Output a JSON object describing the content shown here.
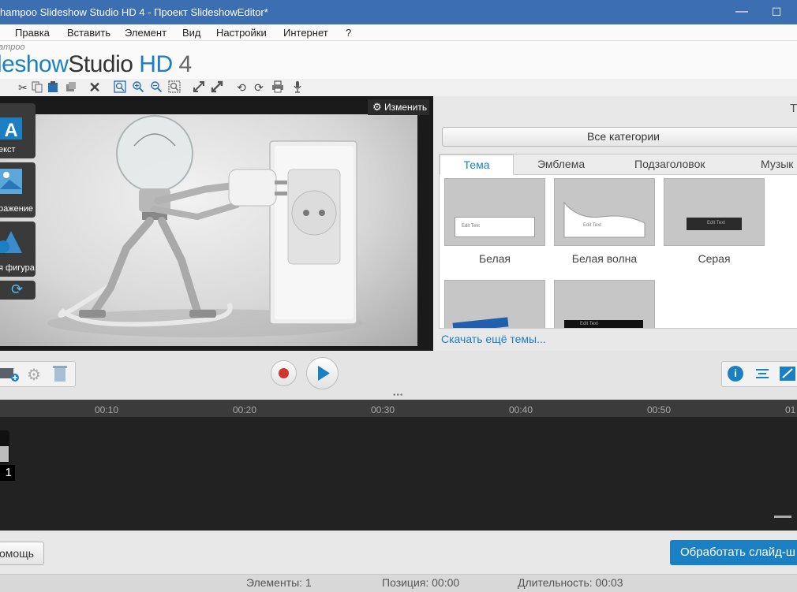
{
  "window": {
    "title": "hampoo Slideshow Studio HD 4 - Проект SlideshowEditor*",
    "minimize": "—",
    "maximize": "☐"
  },
  "menu": [
    "Правка",
    "Вставить",
    "Элемент",
    "Вид",
    "Настройки",
    "Интернет",
    "?"
  ],
  "brand": {
    "sub": "ampoo",
    "logo_a": "leshow",
    "logo_b": "Studio ",
    "logo_c": "HD",
    "logo_d": " 4"
  },
  "toolbar_icons": [
    "cut-icon",
    "copy-icon",
    "paste-icon",
    "duplicate-icon",
    "delete-icon",
    "zoom-fit-icon",
    "zoom-in-icon",
    "zoom-out-icon",
    "zoom-reset-icon",
    "fullscreen-icon",
    "expand-icon",
    "rotate-left-icon",
    "rotate-right-icon",
    "print-icon",
    "mic-icon"
  ],
  "preview": {
    "edit_label": "Изменить"
  },
  "side_tools": {
    "text_label": "екст",
    "image_label": "ражение",
    "shape_label": "я фигура"
  },
  "themes_panel": {
    "letter": "Т",
    "category_label": "Все категории",
    "tabs": [
      "Тема",
      "Эмблема",
      "Подзаголовок",
      "Музык"
    ],
    "items": [
      "Белая",
      "Белая волна",
      "Серая"
    ],
    "thumb_caption": "Edit Text",
    "more_link": "Скачать ещё темы..."
  },
  "timeline": {
    "ticks": [
      "00:10",
      "00:20",
      "00:30",
      "00:40",
      "00:50",
      "01"
    ],
    "clip_number": "1"
  },
  "bottom": {
    "help_label": "омощь",
    "process_label": "Обработать слайд-ш"
  },
  "status": {
    "elements": "Элементы: 1",
    "position": "Позиция: 00:00",
    "duration": "Длительность: 00:03"
  },
  "colors": {
    "accent": "#1b7fc4",
    "titlebar": "#3c6fb2",
    "record": "#d0342c"
  }
}
